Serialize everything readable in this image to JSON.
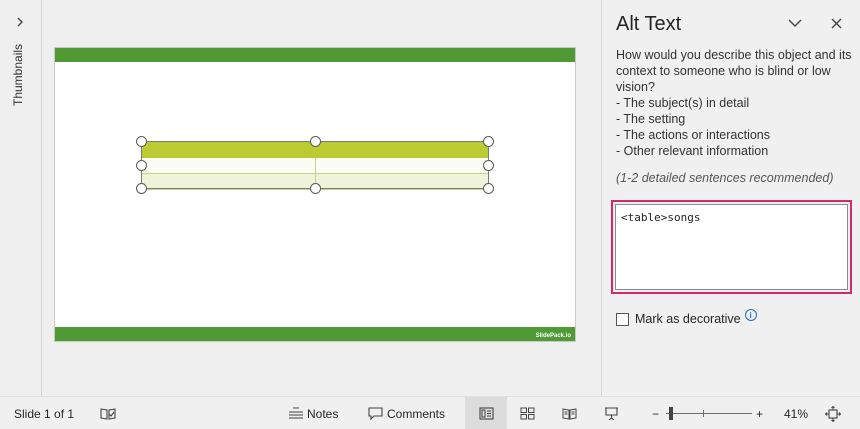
{
  "thumbnails": {
    "label": "Thumbnails"
  },
  "slide": {
    "brand": "SlidePack.io",
    "accent_color": "#4f9a35",
    "table_header_color": "#bdcb33"
  },
  "alt_text_pane": {
    "title": "Alt Text",
    "prompt_lines": [
      "How would you describe this object and its",
      "context to someone who is blind or low",
      "vision?",
      "- The subject(s) in detail",
      "- The setting",
      "- The actions or interactions",
      "- Other relevant information"
    ],
    "hint": "(1-2 detailed sentences recommended)",
    "alt_text_value": "<table>songs",
    "highlight_color": "#d12a6a",
    "decorative_label": "Mark as decorative",
    "decorative_checked": false
  },
  "status_bar": {
    "slide_indicator": "Slide 1 of 1",
    "notes_label": "Notes",
    "comments_label": "Comments",
    "zoom_percent": "41%",
    "zoom_min_label": "−",
    "zoom_max_label": "+"
  }
}
